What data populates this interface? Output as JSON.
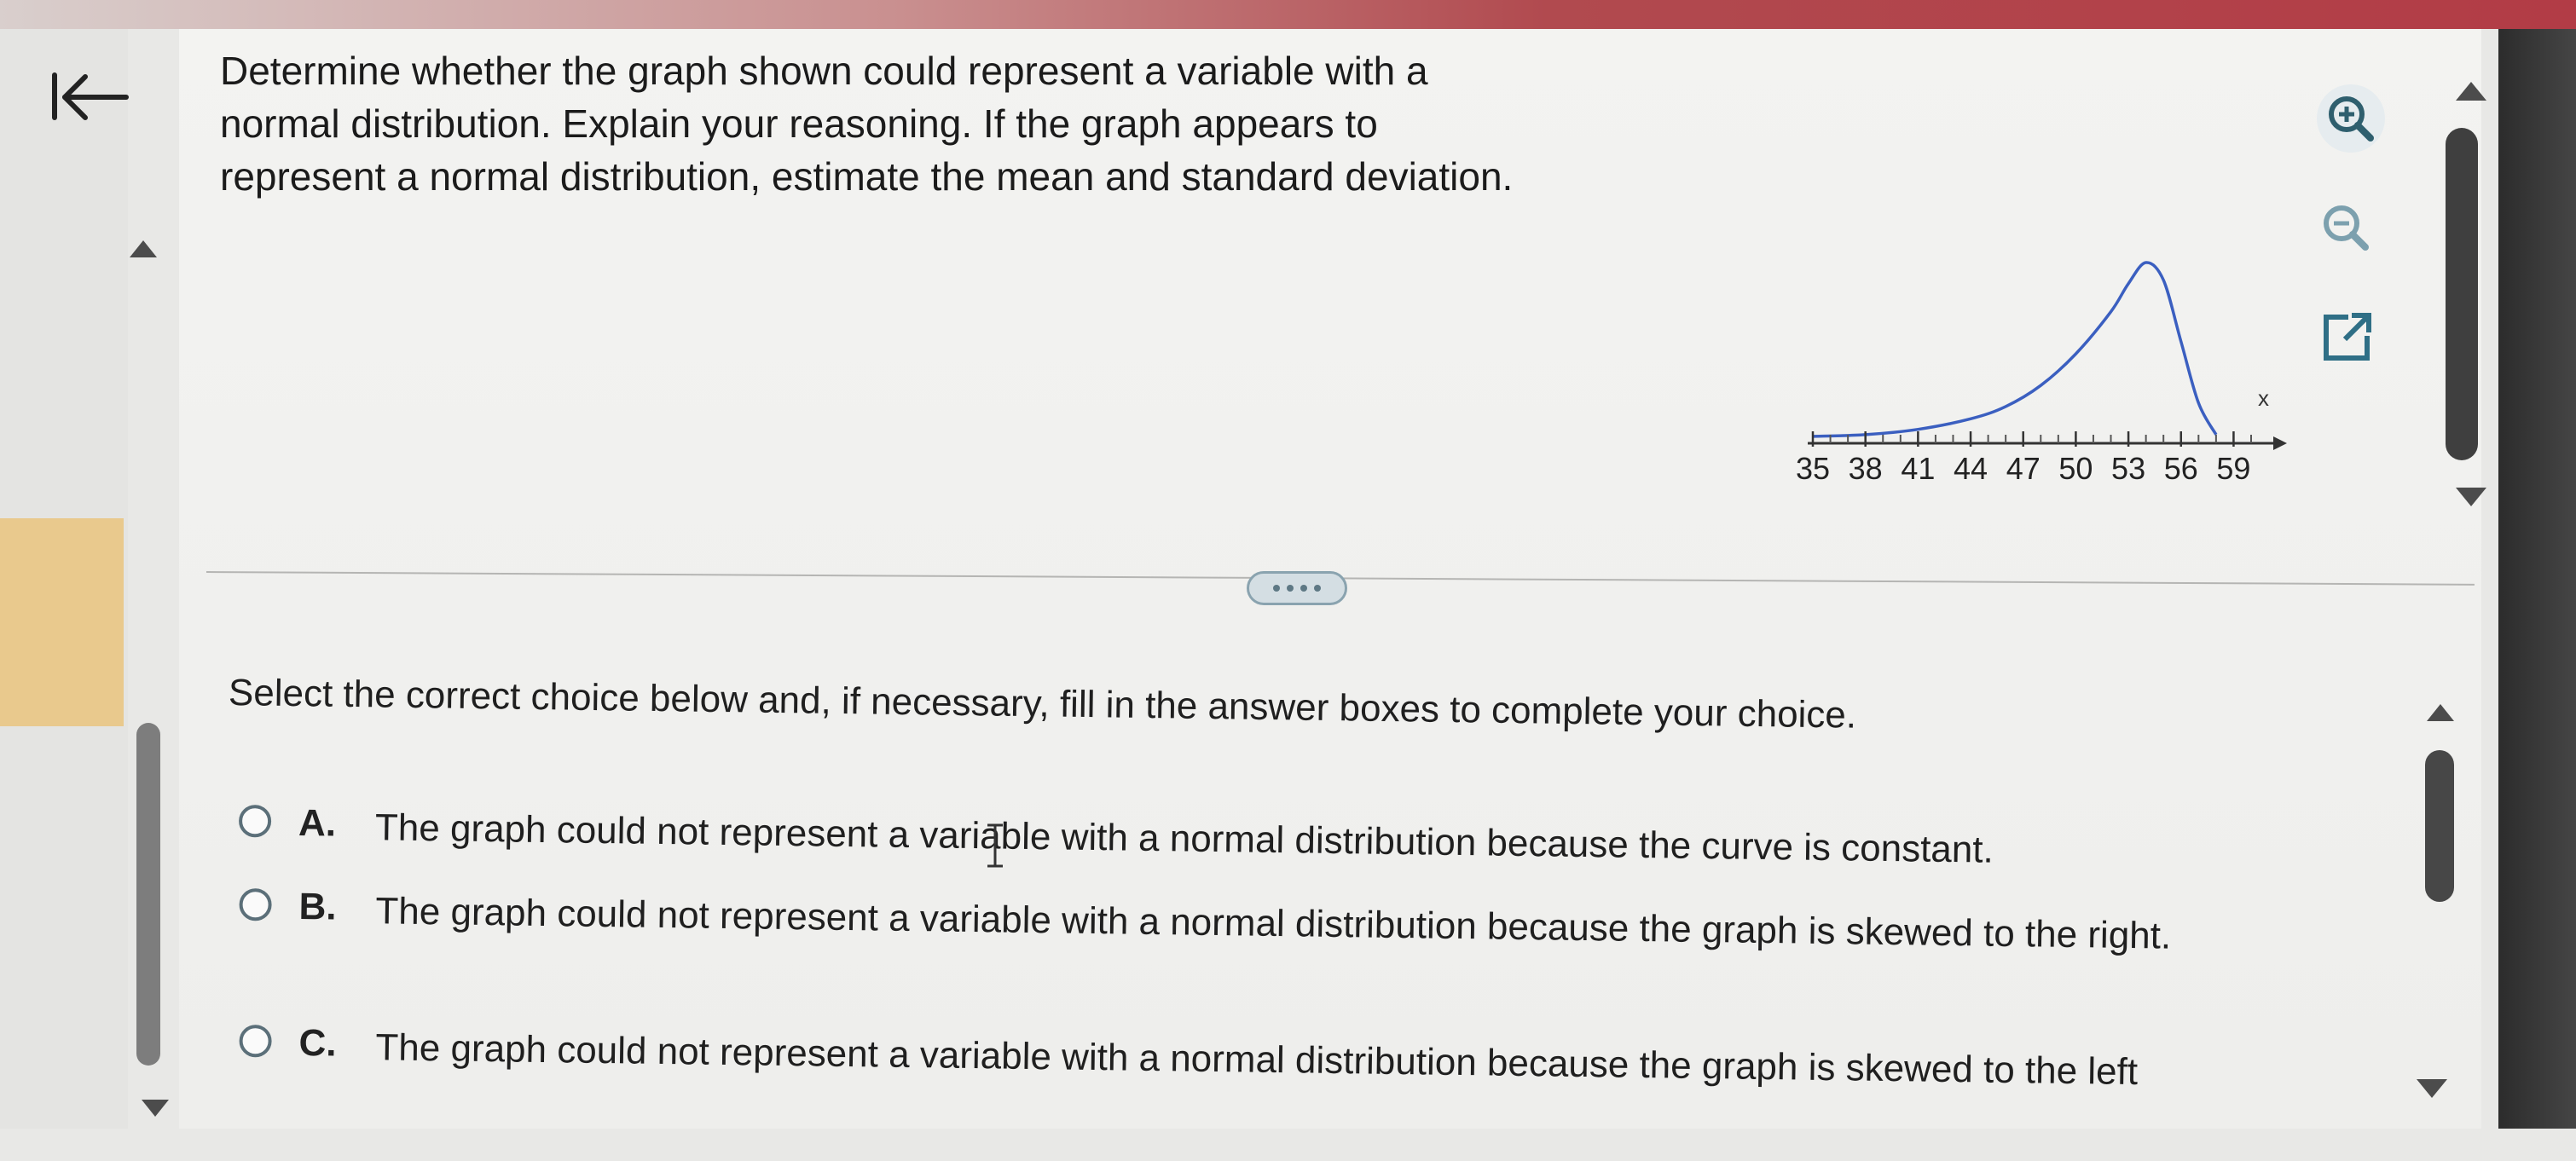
{
  "question": {
    "line1": "Determine whether the graph shown could represent a variable with a",
    "line2": "normal distribution. Explain your reasoning. If the graph appears to",
    "line3": "represent a normal distribution, estimate the mean and standard deviation."
  },
  "toolbar": {
    "zoom_in_icon": "zoom-in-icon",
    "zoom_out_icon": "zoom-out-icon",
    "popout_icon": "popout-icon"
  },
  "navigation": {
    "back_icon": "back-to-start-icon"
  },
  "chart_data": {
    "type": "line",
    "title": "",
    "xlabel": "x",
    "ylabel": "",
    "x_ticks": [
      35,
      38,
      41,
      44,
      47,
      50,
      53,
      56,
      59
    ],
    "x_tick_labels": [
      "35",
      "38",
      "41",
      "44",
      "47",
      "50",
      "53",
      "56",
      "59"
    ],
    "xlim": [
      35,
      60
    ],
    "series": [
      {
        "color": "#3b5fc0",
        "x": [
          35,
          38,
          41,
          44,
          46,
          48,
          50,
          52,
          53,
          54,
          55,
          56,
          57,
          58
        ],
        "y": [
          0.01,
          0.02,
          0.05,
          0.11,
          0.18,
          0.3,
          0.48,
          0.72,
          0.88,
          1.0,
          0.9,
          0.55,
          0.2,
          0.02
        ]
      }
    ]
  },
  "instruction": "Select the correct choice below and, if necessary, fill in the answer boxes to complete your choice.",
  "choices": [
    {
      "letter": "A.",
      "text": "The graph could not represent a variable with a normal distribution because the curve is constant."
    },
    {
      "letter": "B.",
      "text": "The graph could not represent a variable with a normal distribution because the graph is skewed to the right."
    },
    {
      "letter": "C.",
      "text": "The graph could not represent a variable with a normal distribution because the graph is skewed to the left"
    }
  ],
  "colors": {
    "accent_bar": "#b23c46",
    "curve": "#3b5fc0",
    "radio_border": "#5b6f79"
  }
}
